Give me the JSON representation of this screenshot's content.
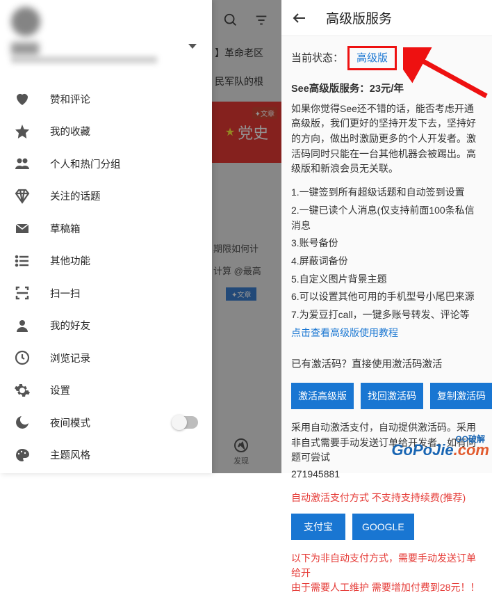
{
  "profile": {
    "dropdown": "▼"
  },
  "menu": [
    {
      "icon": "heart",
      "label": "赞和评论"
    },
    {
      "icon": "star",
      "label": "我的收藏"
    },
    {
      "icon": "group",
      "label": "个人和热门分组"
    },
    {
      "icon": "diamond",
      "label": "关注的话题"
    },
    {
      "icon": "mail",
      "label": "草稿箱"
    },
    {
      "icon": "list",
      "label": "其他功能"
    },
    {
      "icon": "scan",
      "label": "扫一扫"
    },
    {
      "icon": "person",
      "label": "我的好友"
    },
    {
      "icon": "clock",
      "label": "浏览记录"
    },
    {
      "icon": "gear",
      "label": "设置"
    },
    {
      "icon": "moon",
      "label": "夜间模式",
      "switch": true
    },
    {
      "icon": "palette",
      "label": "主题风格"
    }
  ],
  "mid": {
    "line1": "】革命老区",
    "line2": "民军队的根",
    "tag": "✦文章",
    "banner": "党史",
    "line3": "期限如何计",
    "line4": "计算 @最高",
    "btag": "✦文章",
    "nav": "发现"
  },
  "right": {
    "title": "高级版服务",
    "statusLabel": "当前状态：",
    "statusValue": "高级版",
    "serviceTitle": "See高级版服务：23元/年",
    "desc": "如果你觉得See还不错的话，能否考虑开通高级版，我们更好的坚持开发下去，坚持好的方向，做出时激励更多的个人开发者。激活码同时只能在一台其他机器会被踢出。高级版和新浪会员无关联。",
    "features": [
      "1.一键签到所有超级话题和自动签到设置",
      "2.一键已读个人消息(仅支持前面100条私信消息",
      "3.账号备份",
      "4.屏蔽词备份",
      "5.自定义图片背景主题",
      "6.可以设置其他可用的手机型号小尾巴来源",
      "7.为爱豆打call，一键多账号转发、评论等"
    ],
    "tutorialLink": "点击查看高级版使用教程",
    "hasCode": "已有激活码？直接使用激活码激活",
    "btn1": "激活高级版",
    "btn2": "找回激活码",
    "btn3": "复制激活码",
    "autoPay": "采用自动激活支付，自动提供激活码。采用非自式需要手动发送订单给开发者。如有问题可尝试",
    "phone": "271945881",
    "autoRed": "自动激活支付方式 不支持支持续费(推荐)",
    "pay1": "支付宝",
    "pay2": "GOOGLE",
    "warn1": "以下为非自动支付方式，需要手动发送订单给开",
    "warn2": "由于需要人工维护 需要增加付费到28元！！",
    "wm": "GoPoJie",
    "wmsub": "GO破解",
    "wmcom": ".com"
  }
}
